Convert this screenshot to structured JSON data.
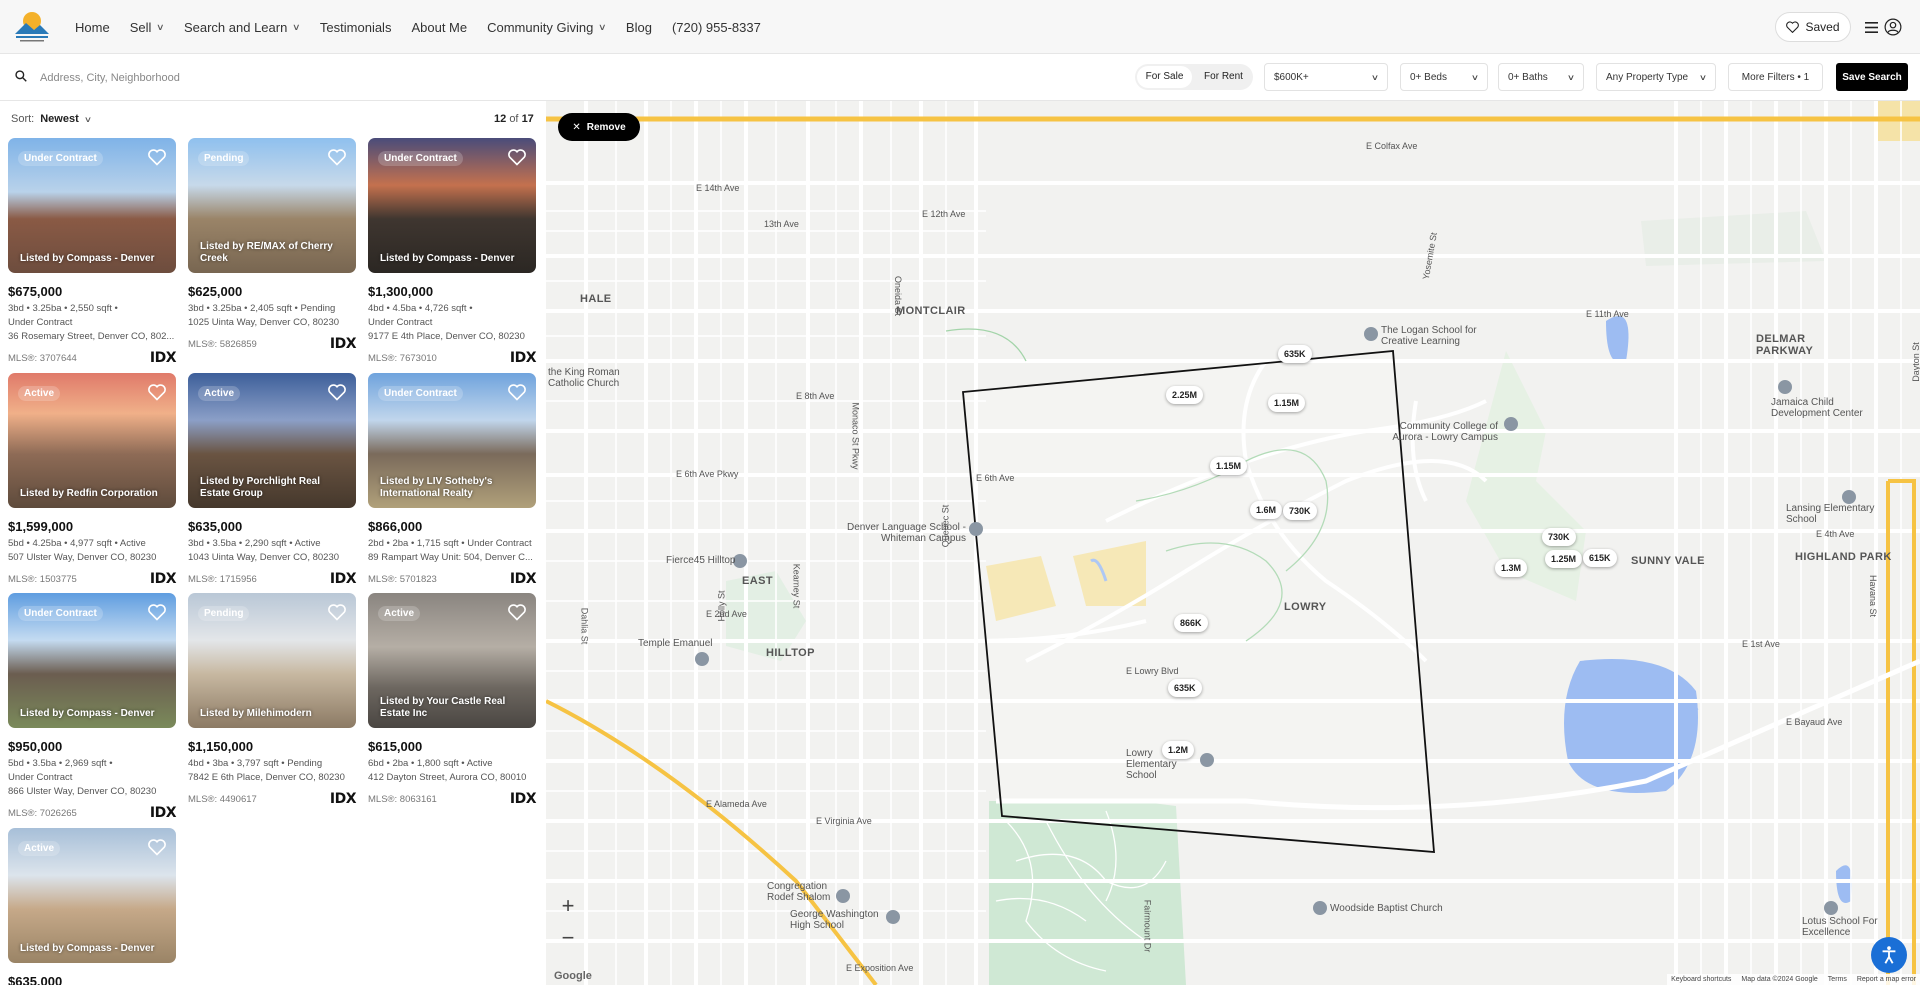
{
  "header": {
    "nav": [
      {
        "label": "Home",
        "dropdown": false
      },
      {
        "label": "Sell",
        "dropdown": true
      },
      {
        "label": "Search and Learn",
        "dropdown": true
      },
      {
        "label": "Testimonials",
        "dropdown": false
      },
      {
        "label": "About Me",
        "dropdown": false
      },
      {
        "label": "Community Giving",
        "dropdown": true
      },
      {
        "label": "Blog",
        "dropdown": false
      },
      {
        "label": "(720) 955-8337",
        "dropdown": false
      }
    ],
    "saved_label": "Saved",
    "icons": {
      "saved": "heart-icon",
      "menu": "hamburger-icon",
      "account": "user-icon"
    }
  },
  "search": {
    "placeholder": "Address, City, Neighborhood",
    "for_sale": "For Sale",
    "for_rent": "For Rent",
    "price": "$600K+",
    "beds": "0+ Beds",
    "baths": "0+ Baths",
    "property_type": "Any Property Type",
    "more_filters": "More Filters • 1",
    "save_search": "Save Search"
  },
  "listings_meta": {
    "sort_label": "Sort:",
    "sort_value": "Newest",
    "count_current": "12",
    "count_of": "of",
    "count_total": "17"
  },
  "listings": [
    {
      "status": "Under Contract",
      "listed_by": "Listed by Compass - Denver",
      "price": "$675,000",
      "facts": "3bd • 3.25ba • 2,550 sqft •",
      "line2": "Under Contract",
      "address": "36 Rosemary Street, Denver CO, 802...",
      "mls": "MLS®: 3707644"
    },
    {
      "status": "Pending",
      "listed_by": "Listed by RE/MAX of Cherry Creek",
      "price": "$625,000",
      "facts": "3bd • 3.25ba • 2,405 sqft • Pending",
      "line2": "",
      "address": "1025 Uinta Way, Denver CO, 80230",
      "mls": "MLS®: 5826859"
    },
    {
      "status": "Under Contract",
      "listed_by": "Listed by Compass - Denver",
      "price": "$1,300,000",
      "facts": "4bd • 4.5ba • 4,726 sqft •",
      "line2": "Under Contract",
      "address": "9177 E 4th Place, Denver CO, 80230",
      "mls": "MLS®: 7673010"
    },
    {
      "status": "Active",
      "listed_by": "Listed by Redfin Corporation",
      "price": "$1,599,000",
      "facts": "5bd • 4.25ba • 4,977 sqft • Active",
      "line2": "",
      "address": "507 Ulster Way, Denver CO, 80230",
      "mls": "MLS®: 1503775"
    },
    {
      "status": "Active",
      "listed_by": "Listed by Porchlight Real Estate Group",
      "price": "$635,000",
      "facts": "3bd • 3.5ba • 2,290 sqft • Active",
      "line2": "",
      "address": "1043 Uinta Way, Denver CO, 80230",
      "mls": "MLS®: 1715956"
    },
    {
      "status": "Under Contract",
      "listed_by": "Listed by LIV Sotheby's International Realty",
      "price": "$866,000",
      "facts": "2bd • 2ba • 1,715 sqft • Under Contract",
      "line2": "",
      "address": "89 Rampart Way Unit: 504, Denver C...",
      "mls": "MLS®: 5701823"
    },
    {
      "status": "Under Contract",
      "listed_by": "Listed by Compass - Denver",
      "price": "$950,000",
      "facts": "5bd • 3.5ba • 2,969 sqft •",
      "line2": "Under Contract",
      "address": "866 Ulster Way, Denver CO, 80230",
      "mls": "MLS®: 7026265"
    },
    {
      "status": "Pending",
      "listed_by": "Listed by Milehimodern",
      "price": "$1,150,000",
      "facts": "4bd • 3ba • 3,797 sqft • Pending",
      "line2": "",
      "address": "7842 E 6th Place, Denver CO, 80230",
      "mls": "MLS®: 4490617"
    },
    {
      "status": "Active",
      "listed_by": "Listed by Your Castle Real Estate Inc",
      "price": "$615,000",
      "facts": "6bd • 2ba • 1,800 sqft • Active",
      "line2": "",
      "address": "412 Dayton Street, Aurora CO, 80010",
      "mls": "MLS®: 8063161"
    },
    {
      "status": "Active",
      "listed_by": "Listed by Compass - Denver",
      "price": "$635,000",
      "facts": "",
      "line2": "",
      "address": "",
      "mls": ""
    }
  ],
  "idx_label": "IDX",
  "map": {
    "remove_label": "Remove",
    "zoom_in": "+",
    "zoom_out": "−",
    "pins": [
      "635K",
      "2.25M",
      "1.15M",
      "1.15M",
      "1.6M",
      "730K",
      "730K",
      "1.25M",
      "1.3M",
      "615K",
      "866K",
      "635K",
      "1.2M"
    ],
    "areas": [
      "HALE",
      "MONTCLAIR",
      "EAST",
      "HILLTOP",
      "LOWRY",
      "DELMAR PARKWAY",
      "SUNNY VALE",
      "HIGHLAND PARK"
    ],
    "pois": [
      "The Logan School for Creative Learning",
      "Community College of Aurora - Lowry Campus",
      "Jamaica Child Development Center",
      "Lansing Elementary School",
      "Denver Language School - Whiteman Campus",
      "Fierce45 Hilltop",
      "Temple Emanuel",
      "Lowry Elementary School",
      "Congregation Rodef Shalom",
      "George Washington High School",
      "Woodside Baptist Church",
      "Lotus School For Excellence",
      "the King Roman Catholic Church"
    ],
    "streets": [
      "E Colfax Ave",
      "E 14th Ave",
      "13th Ave",
      "E 12th Ave",
      "E 11th Ave",
      "E 8th Ave",
      "E 6th Ave Pkwy",
      "E 6th Ave",
      "E 4th Ave",
      "E 2nd Ave",
      "E 1st Ave",
      "E Lowry Blvd",
      "E Bayaud Ave",
      "E Alameda Ave",
      "E Virginia Ave",
      "E Exposition Ave",
      "Quebec St",
      "Yosemite St",
      "Dayton St",
      "Havana St",
      "Monaco St Pkwy",
      "Holly St",
      "Oneida St",
      "Kearney St",
      "Dahlia St",
      "Fairmount Dr"
    ],
    "attribution": [
      "Keyboard shortcuts",
      "Map data ©2024 Google",
      "Terms",
      "Report a map error"
    ],
    "google_label": "Google"
  },
  "colors": {
    "accent": "#000000",
    "highway": "#f6c343",
    "park": "#cfe8d4",
    "water": "#9dbcf2",
    "access": "#1a6fd6"
  }
}
